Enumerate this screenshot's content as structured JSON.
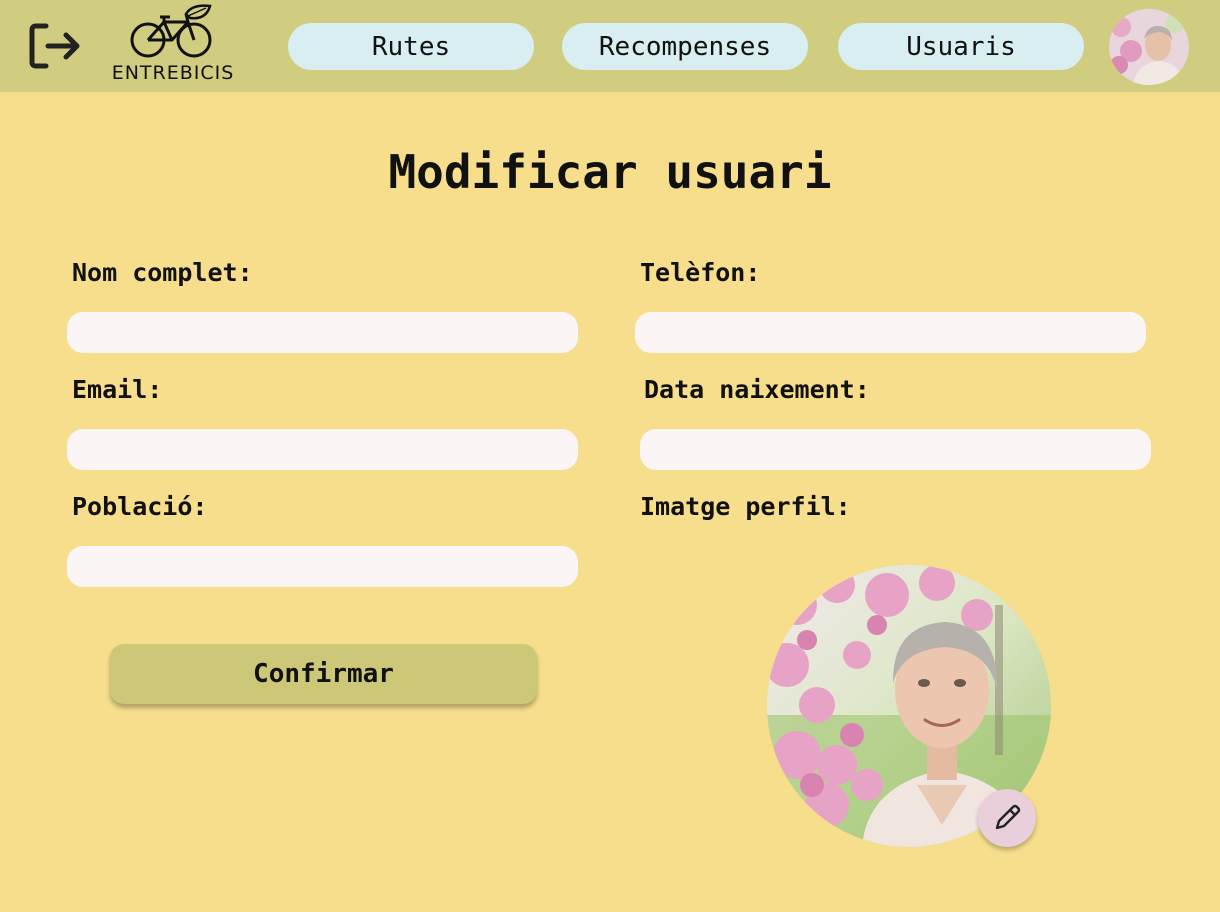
{
  "header": {
    "logo_text": "ENTREBICIS",
    "nav": [
      {
        "label": "Rutes"
      },
      {
        "label": "Recompenses"
      },
      {
        "label": "Usuaris"
      }
    ]
  },
  "page": {
    "title": "Modificar usuari"
  },
  "form": {
    "nom_label": "Nom complet:",
    "telefon_label": "Telèfon:",
    "email_label": "Email:",
    "data_label": "Data naixement:",
    "poblacio_label": "Població:",
    "imatge_label": "Imatge perfil:",
    "nom_value": "",
    "telefon_value": "",
    "email_value": "",
    "data_value": "",
    "poblacio_value": "",
    "confirm_label": "Confirmar"
  },
  "icons": {
    "logout": "logout-icon",
    "edit": "pencil-icon",
    "bike": "bicycle-leaf-icon"
  },
  "colors": {
    "background": "#f6de8d",
    "header": "#d0cd80",
    "nav_button": "#d8eef0",
    "input": "#fbf6f5",
    "confirm": "#ccc877",
    "edit_button": "#e8cfd9"
  }
}
